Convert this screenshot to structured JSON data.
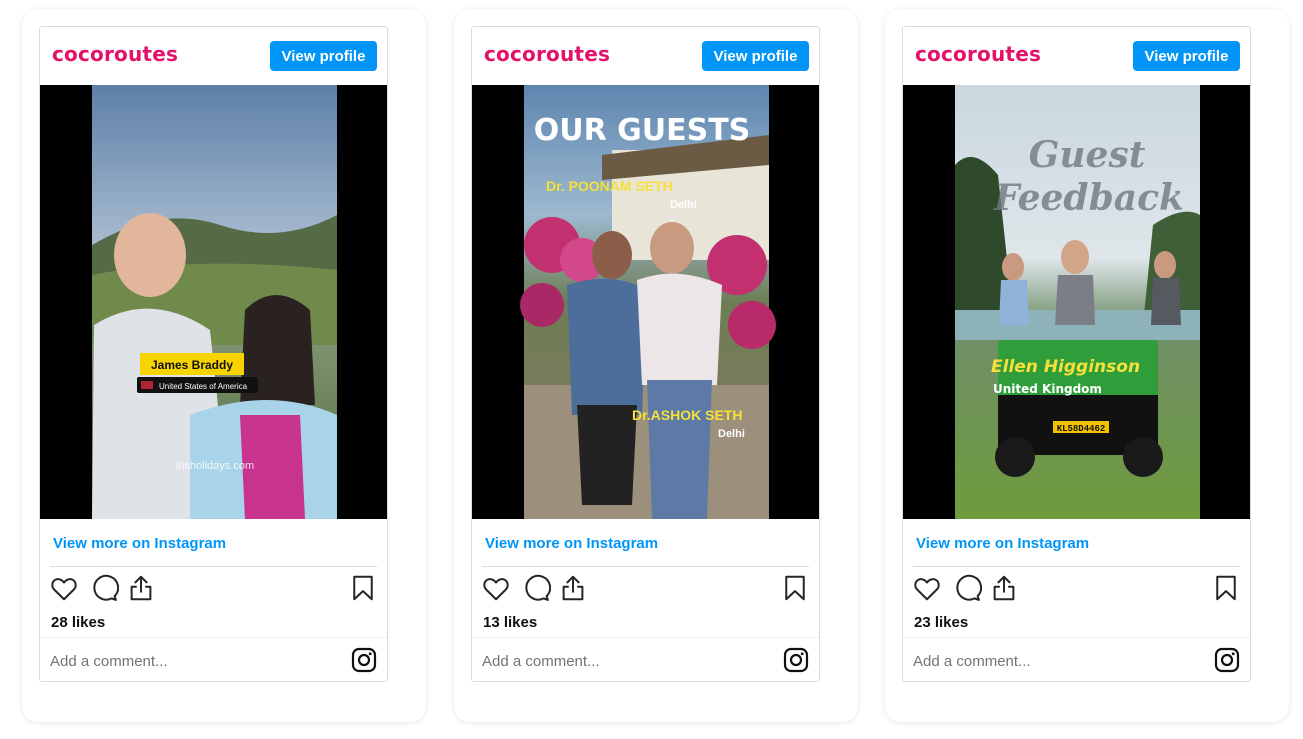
{
  "colors": {
    "brand": "#e4116a",
    "button": "#0095f6",
    "link": "#0095f6"
  },
  "posts": [
    {
      "brand": "cocoroutes",
      "view_profile": "View profile",
      "view_more": "View more on Instagram",
      "likes": "28 likes",
      "comment_placeholder": "Add a comment...",
      "overlay": {
        "name": "James Braddy",
        "country": "United States of America",
        "watermark": "irisholidays.com"
      }
    },
    {
      "brand": "cocoroutes",
      "view_profile": "View profile",
      "view_more": "View more on Instagram",
      "likes": "13 likes",
      "comment_placeholder": "Add a comment...",
      "overlay": {
        "heading": "OUR GUESTS",
        "guest1": "Dr. POONAM SETH",
        "city1": "Delhi",
        "guest2": "Dr.ASHOK SETH",
        "city2": "Delhi"
      }
    },
    {
      "brand": "cocoroutes",
      "view_profile": "View profile",
      "view_more": "View more on Instagram",
      "likes": "23 likes",
      "comment_placeholder": "Add a comment...",
      "overlay": {
        "heading1": "Guest",
        "heading2": "Feedback",
        "name": "Ellen Higginson",
        "country": "United Kingdom",
        "plate": "KL58D4462"
      }
    }
  ]
}
